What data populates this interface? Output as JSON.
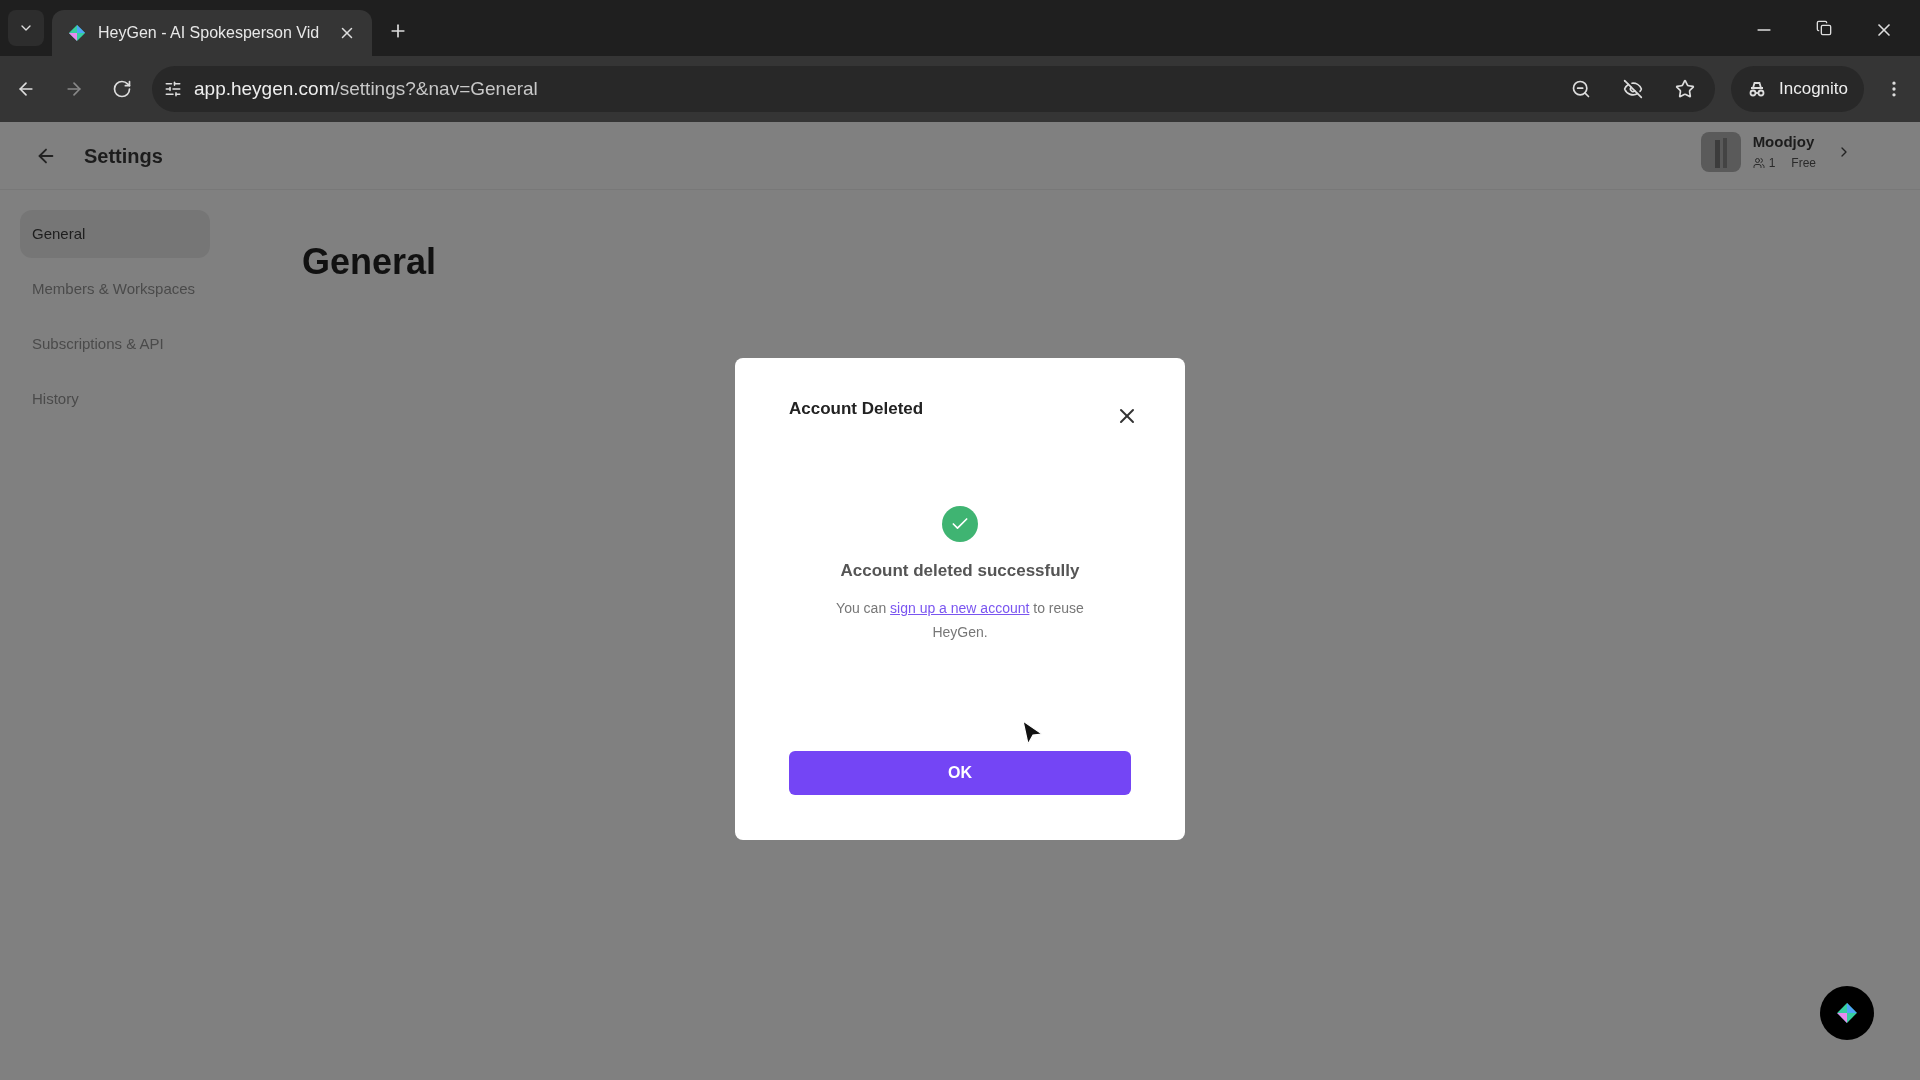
{
  "browser": {
    "tab_title": "HeyGen - AI Spokesperson Vid",
    "url_host": "app.heygen.com",
    "url_path": "/settings?&nav=General",
    "incognito_label": "Incognito"
  },
  "header": {
    "title": "Settings",
    "user": {
      "name": "Moodjoy",
      "members": "1",
      "plan": "Free"
    }
  },
  "sidebar": {
    "items": [
      {
        "label": "General",
        "selected": true
      },
      {
        "label": "Members & Workspaces",
        "selected": false
      },
      {
        "label": "Subscriptions & API",
        "selected": false
      },
      {
        "label": "History",
        "selected": false
      }
    ]
  },
  "main": {
    "heading": "General"
  },
  "dialog": {
    "title": "Account Deleted",
    "message": "Account deleted successfully",
    "body_before": "You can ",
    "link": "sign up a new account",
    "body_after": " to reuse HeyGen.",
    "button": "OK"
  }
}
